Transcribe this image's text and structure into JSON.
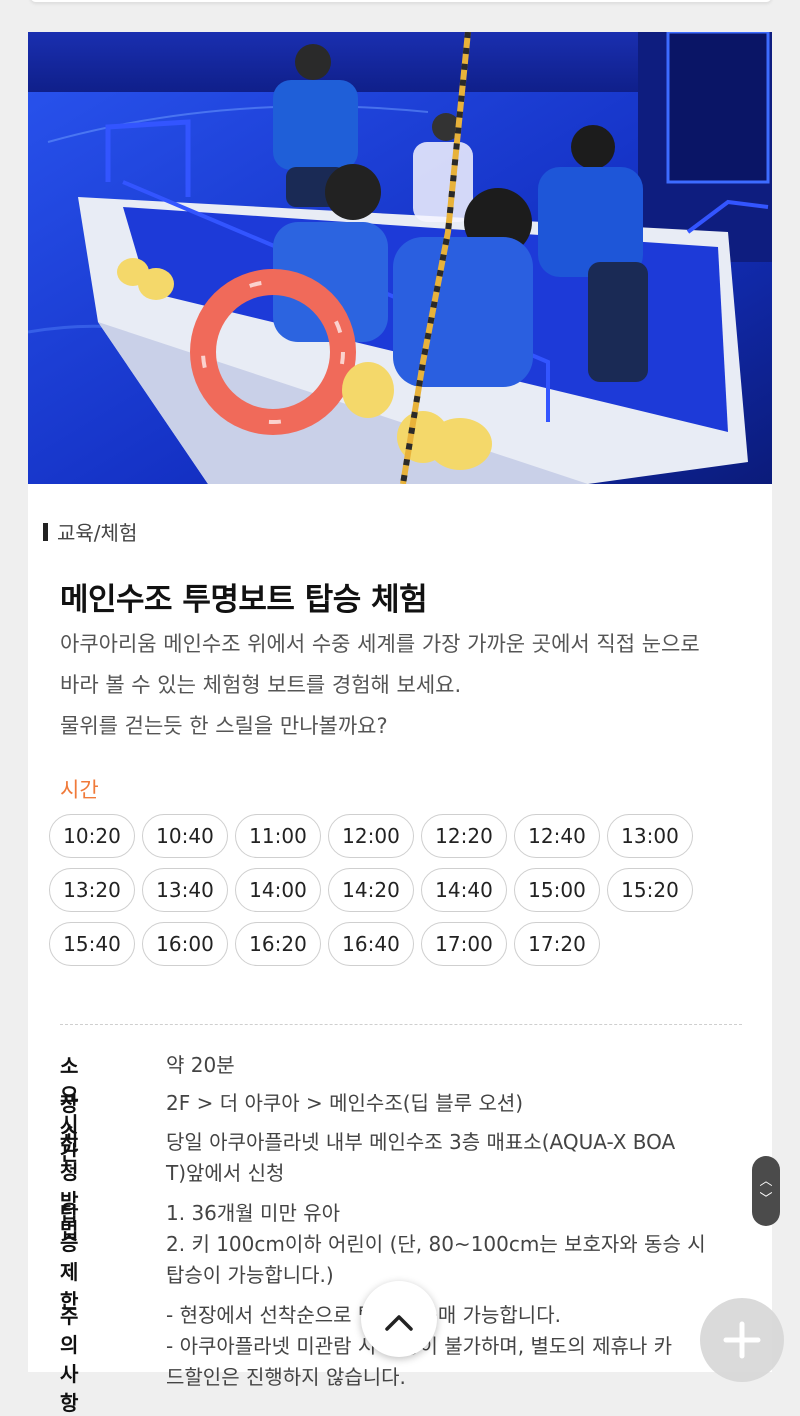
{
  "category": "교육/체험",
  "title": "메인수조 투명보트 탑승 체험",
  "description": [
    "아쿠아리움 메인수조 위에서 수중 세계를 가장 가까운 곳에서 직접 눈으로",
    "바라 볼 수 있는 체험형 보트를 경험해 보세요.",
    "물위를 걷는듯 한 스릴을 만나볼까요?"
  ],
  "time_label": "시간",
  "times": [
    "10:20",
    "10:40",
    "11:00",
    "12:00",
    "12:20",
    "12:40",
    "13:00",
    "13:20",
    "13:40",
    "14:00",
    "14:20",
    "14:40",
    "15:00",
    "15:20",
    "15:40",
    "16:00",
    "16:20",
    "16:40",
    "17:00",
    "17:20"
  ],
  "info": {
    "duration": {
      "label": "소요시간",
      "value": "약 20분"
    },
    "place": {
      "label": "장소",
      "value": "2F > 더 아쿠아 > 메인수조(딥 블루 오션)"
    },
    "apply": {
      "label": "신청방법",
      "lines": [
        "당일 아쿠아플라넷 내부 메인수조 3층 매표소(AQUA-X BOA",
        "T)앞에서 신청"
      ]
    },
    "restrict": {
      "label": "탑승제한",
      "lines": [
        "1. 36개월 미만 유아",
        "2. 키 100cm이하 어린이 (단, 80~100cm는 보호자와 동승 시",
        "탑승이 가능합니다.)"
      ]
    },
    "notice": {
      "label": "주의사항",
      "lines": [
        "- 현장에서 선착순으로 탑승권 구매 가능합니다.",
        "- 아쿠아플라넷 미관람 시 탑승이 불가하며, 별도의 제휴나 카",
        "드할인은 진행하지 않습니다."
      ]
    }
  },
  "colors": {
    "accent": "#f07a3a",
    "photo_water": "#1a3cd8"
  },
  "icons": {
    "scroll_top": "chevron-up-icon",
    "add": "plus-icon"
  }
}
